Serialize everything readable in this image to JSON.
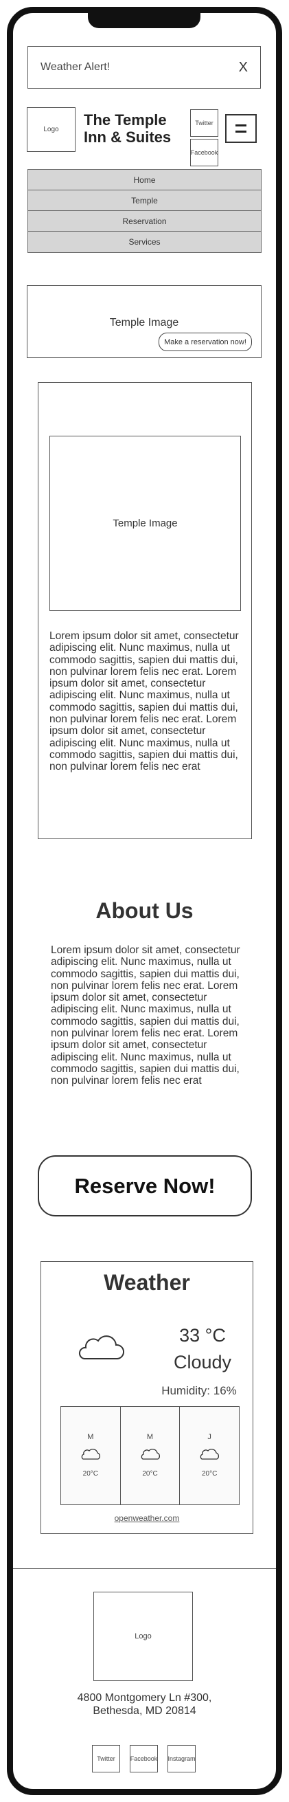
{
  "alert": {
    "text": "Weather Alert!",
    "close": "X"
  },
  "header": {
    "logo": "Logo",
    "brand_line1": "The Temple",
    "brand_line2": "Inn & Suites",
    "twitter": "Twitter",
    "facebook": "Facebook"
  },
  "nav": {
    "items": [
      "Home",
      "Temple",
      "Reservation",
      "Services"
    ]
  },
  "hero": {
    "image_label": "Temple Image",
    "button": "Make a reservation now!"
  },
  "card": {
    "image_label": "Temple Image",
    "text": "Lorem ipsum dolor sit amet, consectetur adipiscing elit. Nunc maximus, nulla ut commodo sagittis, sapien dui mattis dui, non pulvinar lorem felis nec erat. Lorem ipsum dolor sit amet, consectetur adipiscing elit. Nunc maximus, nulla ut commodo sagittis, sapien dui mattis dui, non pulvinar lorem felis nec erat. Lorem ipsum dolor sit amet, consectetur adipiscing elit. Nunc maximus, nulla ut commodo sagittis, sapien dui mattis dui, non pulvinar lorem felis nec erat"
  },
  "about": {
    "title": "About Us",
    "text": "Lorem ipsum dolor sit amet, consectetur adipiscing elit. Nunc maximus, nulla ut commodo sagittis, sapien dui mattis dui, non pulvinar lorem felis nec erat. Lorem ipsum dolor sit amet, consectetur adipiscing elit. Nunc maximus, nulla ut commodo sagittis, sapien dui mattis dui, non pulvinar lorem felis nec erat. Lorem ipsum dolor sit amet, consectetur adipiscing elit. Nunc maximus, nulla ut commodo sagittis, sapien dui mattis dui, non pulvinar lorem felis nec erat"
  },
  "reserve": {
    "label": "Reserve Now!"
  },
  "weather": {
    "title": "Weather",
    "icon": "cloud-icon",
    "temp": "33 °C",
    "condition": "Cloudy",
    "humidity": "Humidity: 16%",
    "forecast": [
      {
        "day": "M",
        "icon": "cloud-icon",
        "temp": "20°C"
      },
      {
        "day": "M",
        "icon": "cloud-icon",
        "temp": "20°C"
      },
      {
        "day": "J",
        "icon": "cloud-icon",
        "temp": "20°C"
      }
    ],
    "link": "openweather.com"
  },
  "footer": {
    "logo": "Logo",
    "address_line1": "4800 Montgomery Ln #300,",
    "address_line2": "Bethesda, MD 20814",
    "social": [
      "Twitter",
      "Facebook",
      "Instagram"
    ]
  }
}
